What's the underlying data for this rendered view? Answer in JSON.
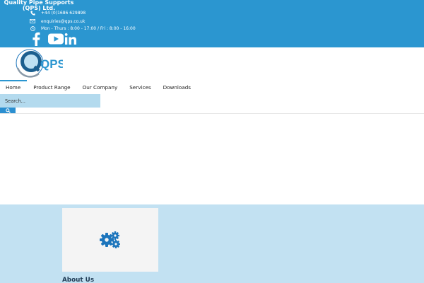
{
  "header": {
    "company_name": "Quality Pipe Supports (QPS) Ltd.",
    "phone": "+44 (0)1686 629898",
    "email": "enquiries@qps.co.uk",
    "hours": "Mon - Thurs : 8:00 - 17:00 / Fri : 8:00 - 16:00",
    "icons": {
      "phone": "phone-icon",
      "email": "envelope-icon",
      "hours": "clock-icon"
    },
    "social": [
      "facebook-icon",
      "youtube-icon",
      "linkedin-icon"
    ]
  },
  "logo": {
    "text": "QPS"
  },
  "nav": {
    "items": [
      {
        "label": "Home",
        "active": true
      },
      {
        "label": "Product Range",
        "active": false
      },
      {
        "label": "Our Company",
        "active": false
      },
      {
        "label": "Services",
        "active": false
      },
      {
        "label": "Downloads",
        "active": false
      }
    ]
  },
  "search": {
    "placeholder": "Search...",
    "button_icon": "search-icon"
  },
  "main": {
    "card_icon": "gears-icon",
    "about_title": "About Us"
  },
  "colors": {
    "brand_blue": "#2b96d0",
    "light_blue": "#c2e1f2",
    "search_bg": "#b3daee",
    "gear_blue": "#1c75bc"
  }
}
